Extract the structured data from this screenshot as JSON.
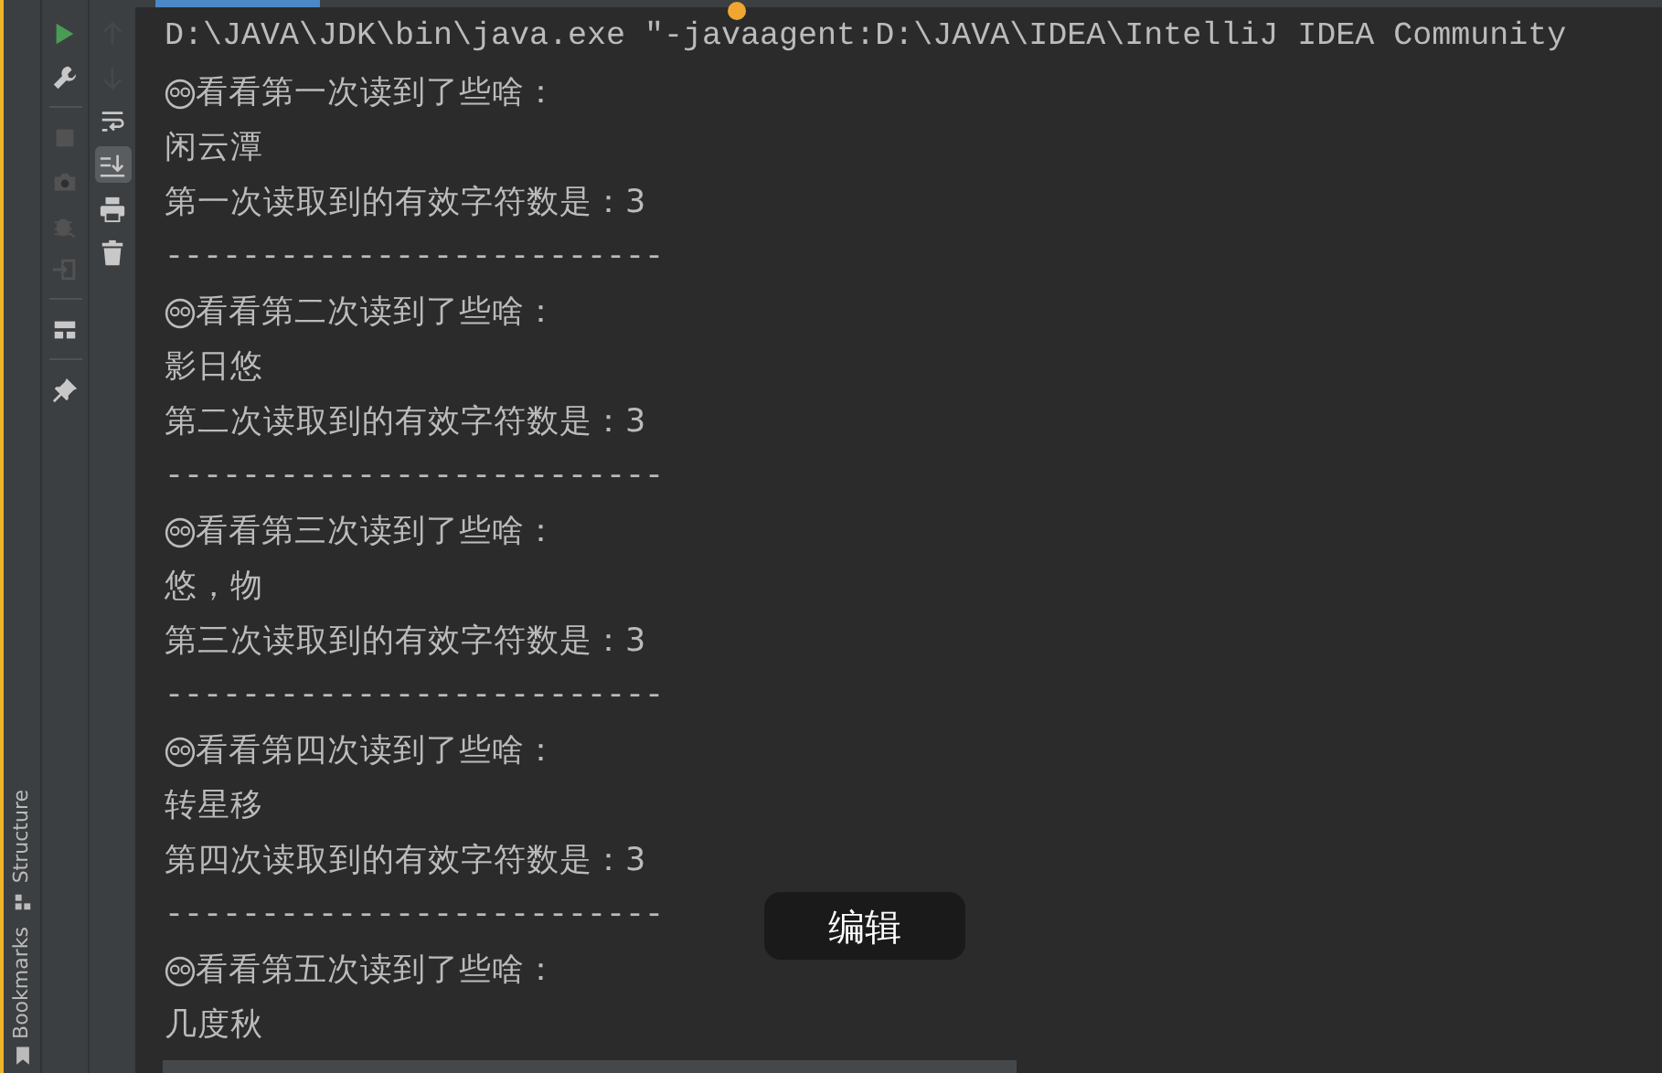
{
  "side_tabs": [
    {
      "label": "Structure",
      "kind": "structure"
    },
    {
      "label": "Bookmarks",
      "kind": "bookmarks"
    }
  ],
  "run_toolbar": [
    {
      "kind": "run",
      "disabled": false
    },
    {
      "kind": "wrench",
      "disabled": false
    },
    {
      "kind": "sep"
    },
    {
      "kind": "stop",
      "disabled": true
    },
    {
      "kind": "camera",
      "disabled": true
    },
    {
      "kind": "bug",
      "disabled": true
    },
    {
      "kind": "exit",
      "disabled": true
    },
    {
      "kind": "sep"
    },
    {
      "kind": "layout",
      "disabled": false
    },
    {
      "kind": "sep"
    },
    {
      "kind": "pin",
      "disabled": false
    }
  ],
  "console_toolbar": [
    {
      "kind": "up",
      "disabled": true,
      "selected": false
    },
    {
      "kind": "down",
      "disabled": true,
      "selected": false
    },
    {
      "kind": "wrap",
      "disabled": false,
      "selected": false
    },
    {
      "kind": "scroll-end",
      "disabled": false,
      "selected": true
    },
    {
      "kind": "print",
      "disabled": false,
      "selected": false
    },
    {
      "kind": "trash",
      "disabled": false,
      "selected": false
    }
  ],
  "console": {
    "lines": [
      {
        "kind": "command",
        "text": "D:\\JAVA\\JDK\\bin\\java.exe \"-javaagent:D:\\JAVA\\IDEA\\IntelliJ IDEA Community"
      },
      {
        "kind": "header",
        "text": "看看第一次读到了些啥："
      },
      {
        "kind": "plain",
        "text": "闲云潭"
      },
      {
        "kind": "plain",
        "text": "第一次读取到的有效字符数是：3"
      },
      {
        "kind": "plain",
        "text": "--------------------------"
      },
      {
        "kind": "header",
        "text": "看看第二次读到了些啥："
      },
      {
        "kind": "plain",
        "text": "影日悠"
      },
      {
        "kind": "plain",
        "text": "第二次读取到的有效字符数是：3"
      },
      {
        "kind": "plain",
        "text": "--------------------------"
      },
      {
        "kind": "header",
        "text": "看看第三次读到了些啥："
      },
      {
        "kind": "plain",
        "text": "悠，物"
      },
      {
        "kind": "plain",
        "text": "第三次读取到的有效字符数是：3"
      },
      {
        "kind": "plain",
        "text": "--------------------------"
      },
      {
        "kind": "header",
        "text": "看看第四次读到了些啥："
      },
      {
        "kind": "plain",
        "text": "转星移"
      },
      {
        "kind": "plain",
        "text": "第四次读取到的有效字符数是：3"
      },
      {
        "kind": "plain",
        "text": "--------------------------"
      },
      {
        "kind": "header",
        "text": "看看第五次读到了些啥："
      },
      {
        "kind": "plain",
        "text": "几度秋"
      },
      {
        "kind": "cut"
      }
    ]
  },
  "overlay_button": {
    "label": "编辑"
  }
}
